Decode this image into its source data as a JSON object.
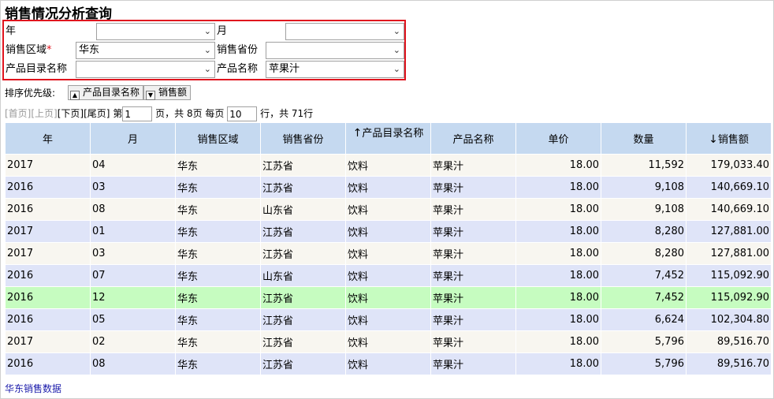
{
  "title": "销售情况分析查询",
  "filters": {
    "year_label": "年",
    "year_value": "",
    "month_label": "月",
    "month_value": "",
    "region_label": "销售区域",
    "region_required": "*",
    "region_value": "华东",
    "province_label": "销售省份",
    "province_value": "",
    "catalog_label": "产品目录名称",
    "catalog_value": "",
    "product_label": "产品名称",
    "product_value": "苹果汁"
  },
  "sort": {
    "label": "排序优先级:",
    "chips": [
      {
        "label": "产品目录名称",
        "dir": "▲"
      },
      {
        "label": "销售额",
        "dir": "▼"
      }
    ]
  },
  "pager": {
    "first": "[首页]",
    "prev": "[上页]",
    "next": "[下页]",
    "last": "[尾页]",
    "page_prefix": "第",
    "page_value": "1",
    "page_suffix": "页，共 8页 每页",
    "per_page_value": "10",
    "total_text": "行，共 71行"
  },
  "table": {
    "columns": [
      "年",
      "月",
      "销售区域",
      "销售省份",
      "产品目录名称",
      "产品名称",
      "单价",
      "数量",
      "销售额"
    ],
    "sort_marks": {
      "4": "↑",
      "8": "↓"
    },
    "highlight_row": 6,
    "rows": [
      [
        "2017",
        "04",
        "华东",
        "江苏省",
        "饮料",
        "苹果汁",
        "18.00",
        "11,592",
        "179,033.40"
      ],
      [
        "2016",
        "03",
        "华东",
        "江苏省",
        "饮料",
        "苹果汁",
        "18.00",
        "9,108",
        "140,669.10"
      ],
      [
        "2016",
        "08",
        "华东",
        "山东省",
        "饮料",
        "苹果汁",
        "18.00",
        "9,108",
        "140,669.10"
      ],
      [
        "2017",
        "01",
        "华东",
        "江苏省",
        "饮料",
        "苹果汁",
        "18.00",
        "8,280",
        "127,881.00"
      ],
      [
        "2017",
        "03",
        "华东",
        "江苏省",
        "饮料",
        "苹果汁",
        "18.00",
        "8,280",
        "127,881.00"
      ],
      [
        "2016",
        "07",
        "华东",
        "山东省",
        "饮料",
        "苹果汁",
        "18.00",
        "7,452",
        "115,092.90"
      ],
      [
        "2016",
        "12",
        "华东",
        "江苏省",
        "饮料",
        "苹果汁",
        "18.00",
        "7,452",
        "115,092.90"
      ],
      [
        "2016",
        "05",
        "华东",
        "江苏省",
        "饮料",
        "苹果汁",
        "18.00",
        "6,624",
        "102,304.80"
      ],
      [
        "2017",
        "02",
        "华东",
        "江苏省",
        "饮料",
        "苹果汁",
        "18.00",
        "5,796",
        "89,516.70"
      ],
      [
        "2016",
        "08",
        "华东",
        "江苏省",
        "饮料",
        "苹果汁",
        "18.00",
        "5,796",
        "89,516.70"
      ]
    ]
  },
  "footer_link": "华东销售数据"
}
